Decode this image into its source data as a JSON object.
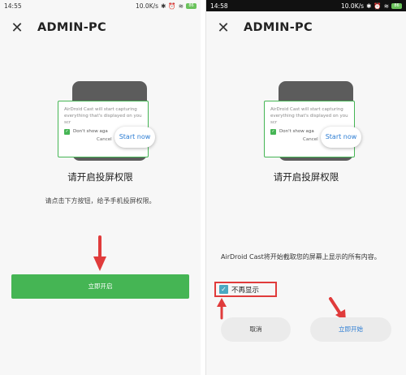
{
  "colors": {
    "accent_green": "#45b554",
    "link_blue": "#2b7cd3",
    "annotation_red": "#e03b3b"
  },
  "left": {
    "status": {
      "time": "14:55",
      "speed": "10.0K/s",
      "battery": "86"
    },
    "title": "ADMIN-PC",
    "illustration": {
      "dialog_text": "AirDroid Cast will start capturing everything that's displayed on you scr",
      "checkbox_label": "Don't show aga",
      "cancel": "Cancel",
      "start_now": "Start now"
    },
    "heading": "请开启投屏权限",
    "description": "请点击下方按钮，给予手机投屏权限。",
    "button": "立即开启"
  },
  "right": {
    "status": {
      "time": "14:58",
      "speed": "10.0K/s",
      "battery": "86"
    },
    "title": "ADMIN-PC",
    "illustration": {
      "dialog_text": "AirDroid Cast will start capturing everything that's displayed on you scr",
      "checkbox_label": "Don't show aga",
      "cancel": "Cancel",
      "start_now": "Start now"
    },
    "heading": "请开启投屏权限",
    "cast_message": "AirDroid Cast将开始截取您的屏幕上显示的所有内容。",
    "checkbox_label": "不再显示",
    "cancel_button": "取消",
    "start_button": "立即开始"
  }
}
